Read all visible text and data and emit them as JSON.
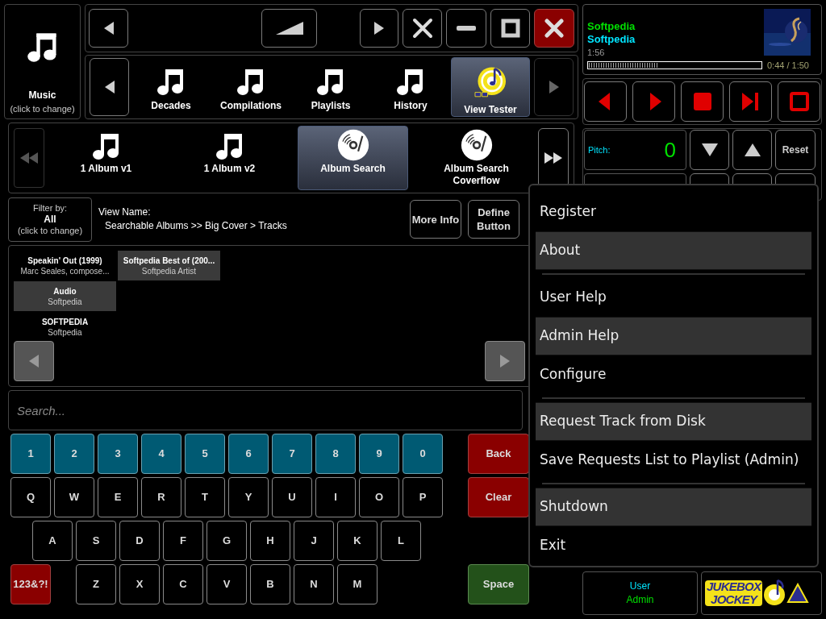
{
  "source": {
    "label": "Music",
    "hint": "(click to change)"
  },
  "categories": [
    {
      "label": "Decades",
      "kind": "note",
      "selected": false
    },
    {
      "label": "Compilations",
      "kind": "note",
      "selected": false
    },
    {
      "label": "Playlists",
      "kind": "note",
      "selected": false
    },
    {
      "label": "History",
      "kind": "note",
      "selected": false
    },
    {
      "label": "View Tester",
      "kind": "logo",
      "selected": true
    }
  ],
  "views": [
    {
      "label": "1 Album v1",
      "kind": "note",
      "selected": false
    },
    {
      "label": "1 Album v2",
      "kind": "note",
      "selected": false
    },
    {
      "label": "Album Search",
      "kind": "disc",
      "selected": true
    },
    {
      "label": "Album Search Coverflow",
      "kind": "disc",
      "selected": false
    }
  ],
  "filter": {
    "caption": "Filter by:",
    "value": "All",
    "hint": "(click to change)"
  },
  "view_name": {
    "label": "View Name:",
    "path": "Searchable Albums >> Big Cover > Tracks"
  },
  "view_buttons": [
    "More Info",
    "Define Button"
  ],
  "albums": [
    {
      "title": "Speakin' Out (1999)",
      "artist": "Marc Seales, compose...",
      "selected": false
    },
    {
      "title": "Audio",
      "artist": "Softpedia",
      "selected": true
    },
    {
      "title": "SOFTPEDIA",
      "artist": "Softpedia",
      "selected": false
    },
    {
      "title": "Softpedia Best of (200...",
      "artist": "Softpedia Artist",
      "selected": true
    }
  ],
  "search": {
    "placeholder": "Search..."
  },
  "keyboard": {
    "rows": [
      [
        {
          "label": "1",
          "kind": "digit"
        },
        {
          "label": "2",
          "kind": "digit"
        },
        {
          "label": "3",
          "kind": "digit"
        },
        {
          "label": "4",
          "kind": "digit"
        },
        {
          "label": "5",
          "kind": "digit"
        },
        {
          "label": "6",
          "kind": "digit"
        },
        {
          "label": "7",
          "kind": "digit"
        },
        {
          "label": "8",
          "kind": "digit"
        },
        {
          "label": "9",
          "kind": "digit"
        },
        {
          "label": "0",
          "kind": "digit"
        }
      ],
      [
        {
          "label": "Q",
          "kind": "letter"
        },
        {
          "label": "W",
          "kind": "letter"
        },
        {
          "label": "E",
          "kind": "letter"
        },
        {
          "label": "R",
          "kind": "letter"
        },
        {
          "label": "T",
          "kind": "letter"
        },
        {
          "label": "Y",
          "kind": "letter"
        },
        {
          "label": "U",
          "kind": "letter"
        },
        {
          "label": "I",
          "kind": "letter"
        },
        {
          "label": "O",
          "kind": "letter"
        },
        {
          "label": "P",
          "kind": "letter"
        }
      ],
      [
        {
          "label": "A",
          "kind": "letter"
        },
        {
          "label": "S",
          "kind": "letter"
        },
        {
          "label": "D",
          "kind": "letter"
        },
        {
          "label": "F",
          "kind": "letter"
        },
        {
          "label": "G",
          "kind": "letter"
        },
        {
          "label": "H",
          "kind": "letter"
        },
        {
          "label": "J",
          "kind": "letter"
        },
        {
          "label": "K",
          "kind": "letter"
        },
        {
          "label": "L",
          "kind": "letter"
        }
      ],
      [
        {
          "label": "123&?!",
          "kind": "mode"
        },
        {
          "label": "Z",
          "kind": "letter"
        },
        {
          "label": "X",
          "kind": "letter"
        },
        {
          "label": "C",
          "kind": "letter"
        },
        {
          "label": "V",
          "kind": "letter"
        },
        {
          "label": "B",
          "kind": "letter"
        },
        {
          "label": "N",
          "kind": "letter"
        },
        {
          "label": "M",
          "kind": "letter"
        }
      ]
    ],
    "side": [
      {
        "label": "Back",
        "kind": "action"
      },
      {
        "label": "Clear",
        "kind": "action"
      },
      {
        "label": "Space",
        "kind": "space"
      }
    ]
  },
  "now_playing": {
    "title": "Softpedia",
    "artist": "Softpedia",
    "length": "1:56",
    "level": 0.4,
    "time": "0:44 / 1:50"
  },
  "pitch": {
    "label": "Pitch:",
    "value": "0",
    "reset": "Reset"
  },
  "user": {
    "label": "User",
    "role": "Admin"
  },
  "logo": {
    "line_1": "JUKEBOX",
    "line_2": "JOCKEY"
  },
  "menu": [
    {
      "kind": "item",
      "label": "Register",
      "highlighted": false
    },
    {
      "kind": "item",
      "label": "About",
      "highlighted": true
    },
    {
      "kind": "separator"
    },
    {
      "kind": "item",
      "label": "User Help",
      "highlighted": false
    },
    {
      "kind": "item",
      "label": "Admin Help",
      "highlighted": true
    },
    {
      "kind": "item",
      "label": "Configure",
      "highlighted": false
    },
    {
      "kind": "separator"
    },
    {
      "kind": "item",
      "label": "Request Track from Disk",
      "highlighted": true
    },
    {
      "kind": "item",
      "label": "Save Requests List to Playlist (Admin)",
      "highlighted": false
    },
    {
      "kind": "separator"
    },
    {
      "kind": "item",
      "label": "Shutdown",
      "highlighted": true
    },
    {
      "kind": "item",
      "label": "Exit",
      "highlighted": false
    }
  ]
}
